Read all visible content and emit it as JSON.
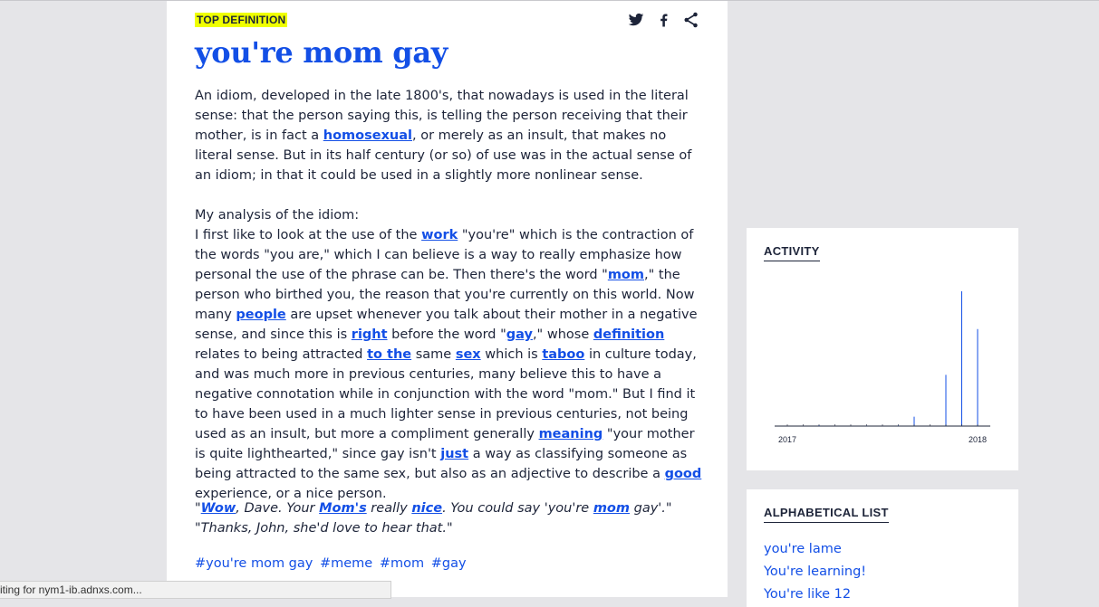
{
  "definition": {
    "badge": "TOP DEFINITION",
    "title": "you're mom gay",
    "paragraph1": [
      {
        "t": "An idiom, developed in the late 1800's, that nowadays is used in the literal sense: that the person saying this, is telling the person receiving that their mother, is in fact a "
      },
      {
        "t": "homosexual",
        "link": true
      },
      {
        "t": ", or merely as an insult, that makes no literal sense. But in its half century (or so) of use was in the actual sense of an idiom; in that it could be used in a slightly more nonlinear sense."
      }
    ],
    "paragraph2": [
      {
        "t": "My analysis of the idiom:"
      },
      {
        "br": true
      },
      {
        "t": "I first like to look at the use of the "
      },
      {
        "t": "work",
        "link": true
      },
      {
        "t": " \"you're\" which is the contraction of the words \"you are,\" which I can believe is a way to really emphasize how personal the use of the phrase can be. Then there's the word \""
      },
      {
        "t": "mom",
        "link": true
      },
      {
        "t": ",\" the person who birthed you, the reason that you're currently on this world. Now many "
      },
      {
        "t": "people",
        "link": true
      },
      {
        "t": " are upset whenever you talk about their mother in a negative sense, and since this is "
      },
      {
        "t": "right",
        "link": true
      },
      {
        "t": " before the word \""
      },
      {
        "t": "gay",
        "link": true
      },
      {
        "t": ",\" whose "
      },
      {
        "t": "definition",
        "link": true
      },
      {
        "t": " relates to being attracted "
      },
      {
        "t": "to the",
        "link": true
      },
      {
        "t": " same "
      },
      {
        "t": "sex",
        "link": true
      },
      {
        "t": " which is "
      },
      {
        "t": "taboo",
        "link": true
      },
      {
        "t": " in culture today, and was much more in previous centuries, many believe this to have a negative connotation while in conjunction with the word \"mom.\" But I find it to have been used in a much lighter sense in previous centuries, not being used as an insult, but more a compliment generally "
      },
      {
        "t": "meaning",
        "link": true
      },
      {
        "t": " \"your mother is quite lighthearted,\" since gay isn't "
      },
      {
        "t": "just",
        "link": true
      },
      {
        "t": " a way as classifying someone as being attracted to the same sex, but also as an adjective to describe a "
      },
      {
        "t": "good",
        "link": true
      },
      {
        "t": " experience, or a nice person."
      }
    ],
    "example_line1": [
      {
        "t": "\""
      },
      {
        "t": "Wow",
        "link": true
      },
      {
        "t": ", Dave. Your "
      },
      {
        "t": "Mom's",
        "link": true
      },
      {
        "t": " really "
      },
      {
        "t": "nice",
        "link": true
      },
      {
        "t": ". You could say 'you're "
      },
      {
        "t": "mom",
        "link": true
      },
      {
        "t": " gay'.\""
      }
    ],
    "example_line2": [
      {
        "t": "\"Thanks, John, she'd love to hear that.\""
      }
    ],
    "tags": [
      "#you're mom gay",
      "#meme",
      "#mom",
      "#gay"
    ]
  },
  "share": {
    "icons": [
      "twitter-icon",
      "facebook-icon",
      "share-icon"
    ]
  },
  "activity": {
    "title": "ACTIVITY",
    "chart_data": {
      "type": "bar",
      "x_tick_labels": [
        "2017",
        "2018"
      ],
      "x": [
        "2017-01",
        "2017-02",
        "2017-03",
        "2017-04",
        "2017-05",
        "2017-06",
        "2017-07",
        "2017-08",
        "2017-09",
        "2017-10",
        "2017-11",
        "2017-12",
        "2018-01"
      ],
      "values": [
        0,
        0,
        0.6,
        0,
        0,
        0.2,
        0,
        0.4,
        7,
        0,
        38,
        100,
        72
      ],
      "ylim": [
        0,
        100
      ],
      "color": "#134fe6",
      "grid": false,
      "legend": "none"
    }
  },
  "alphabetical": {
    "title": "ALPHABETICAL LIST",
    "items": [
      "you're lame",
      "You're learning!",
      "You're like 12"
    ]
  },
  "status_bar": {
    "text": "iting for nym1-ib.adnxs.com..."
  },
  "colors": {
    "link": "#134fe6",
    "badge_bg": "#efff00",
    "text": "#1d2439",
    "page_bg": "#e5e5e8"
  }
}
